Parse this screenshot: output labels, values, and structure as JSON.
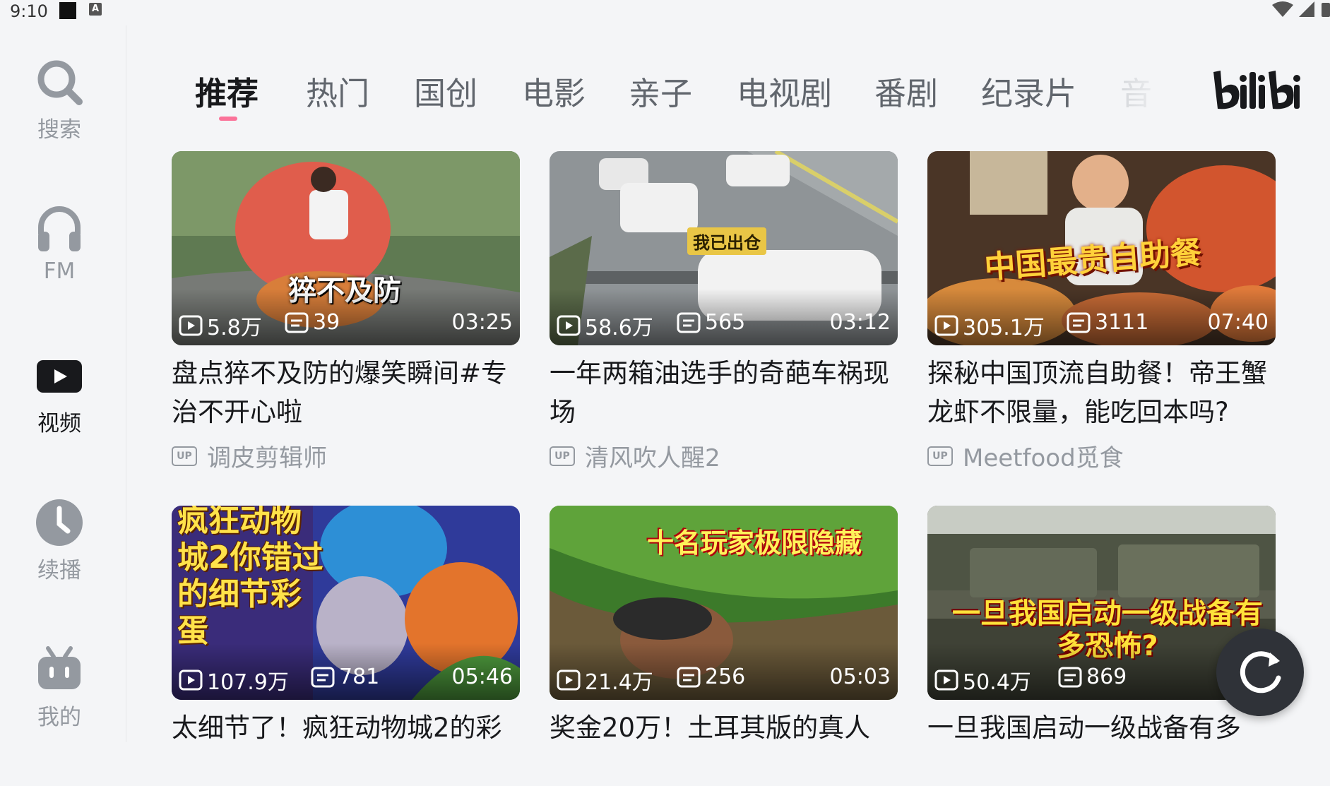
{
  "status_bar": {
    "time": "9:10",
    "indicator": "A"
  },
  "sidebar": {
    "items": [
      {
        "label": "搜索",
        "icon": "search-icon"
      },
      {
        "label": "FM",
        "icon": "headphones-icon"
      },
      {
        "label": "视频",
        "icon": "video-play-icon",
        "active": true
      },
      {
        "label": "续播",
        "icon": "clock-icon"
      },
      {
        "label": "我的",
        "icon": "tv-mascot-icon"
      }
    ]
  },
  "tabs": [
    {
      "label": "推荐",
      "active": true
    },
    {
      "label": "热门"
    },
    {
      "label": "国创"
    },
    {
      "label": "电影"
    },
    {
      "label": "亲子"
    },
    {
      "label": "电视剧"
    },
    {
      "label": "番剧"
    },
    {
      "label": "纪录片"
    },
    {
      "label": "音"
    }
  ],
  "brand": {
    "logo": "bilibili",
    "accent": "#fb7299"
  },
  "videos": [
    {
      "title": "盘点猝不及防的爆笑瞬间#专治不开心啦",
      "uploader": "调皮剪辑师",
      "views": "5.8万",
      "danmaku": "39",
      "duration": "03:25",
      "overlay": "猝不及防"
    },
    {
      "title": "一年两箱油选手的奇葩车祸现场",
      "uploader": "清风吹人醒2",
      "views": "58.6万",
      "danmaku": "565",
      "duration": "03:12",
      "overlay": "我已出仓"
    },
    {
      "title": "探秘中国顶流自助餐！帝王蟹龙虾不限量，能吃回本吗?",
      "uploader": "Meetfood觅食",
      "views": "305.1万",
      "danmaku": "3111",
      "duration": "07:40",
      "overlay": "中国最贵自助餐"
    },
    {
      "title": "太细节了！疯狂动物城2的彩",
      "uploader": "",
      "views": "107.9万",
      "danmaku": "781",
      "duration": "05:46",
      "overlay": "疯狂动物城2你错过的细节彩蛋"
    },
    {
      "title": "奖金20万！土耳其版的真人",
      "uploader": "",
      "views": "21.4万",
      "danmaku": "256",
      "duration": "05:03",
      "overlay": "十名玩家极限隐藏"
    },
    {
      "title": "一旦我国启动一级战备有多",
      "uploader": "",
      "views": "50.4万",
      "danmaku": "869",
      "duration": "",
      "overlay": "一旦我国启动一级战备有多恐怖?"
    }
  ],
  "up_badge": "UP"
}
